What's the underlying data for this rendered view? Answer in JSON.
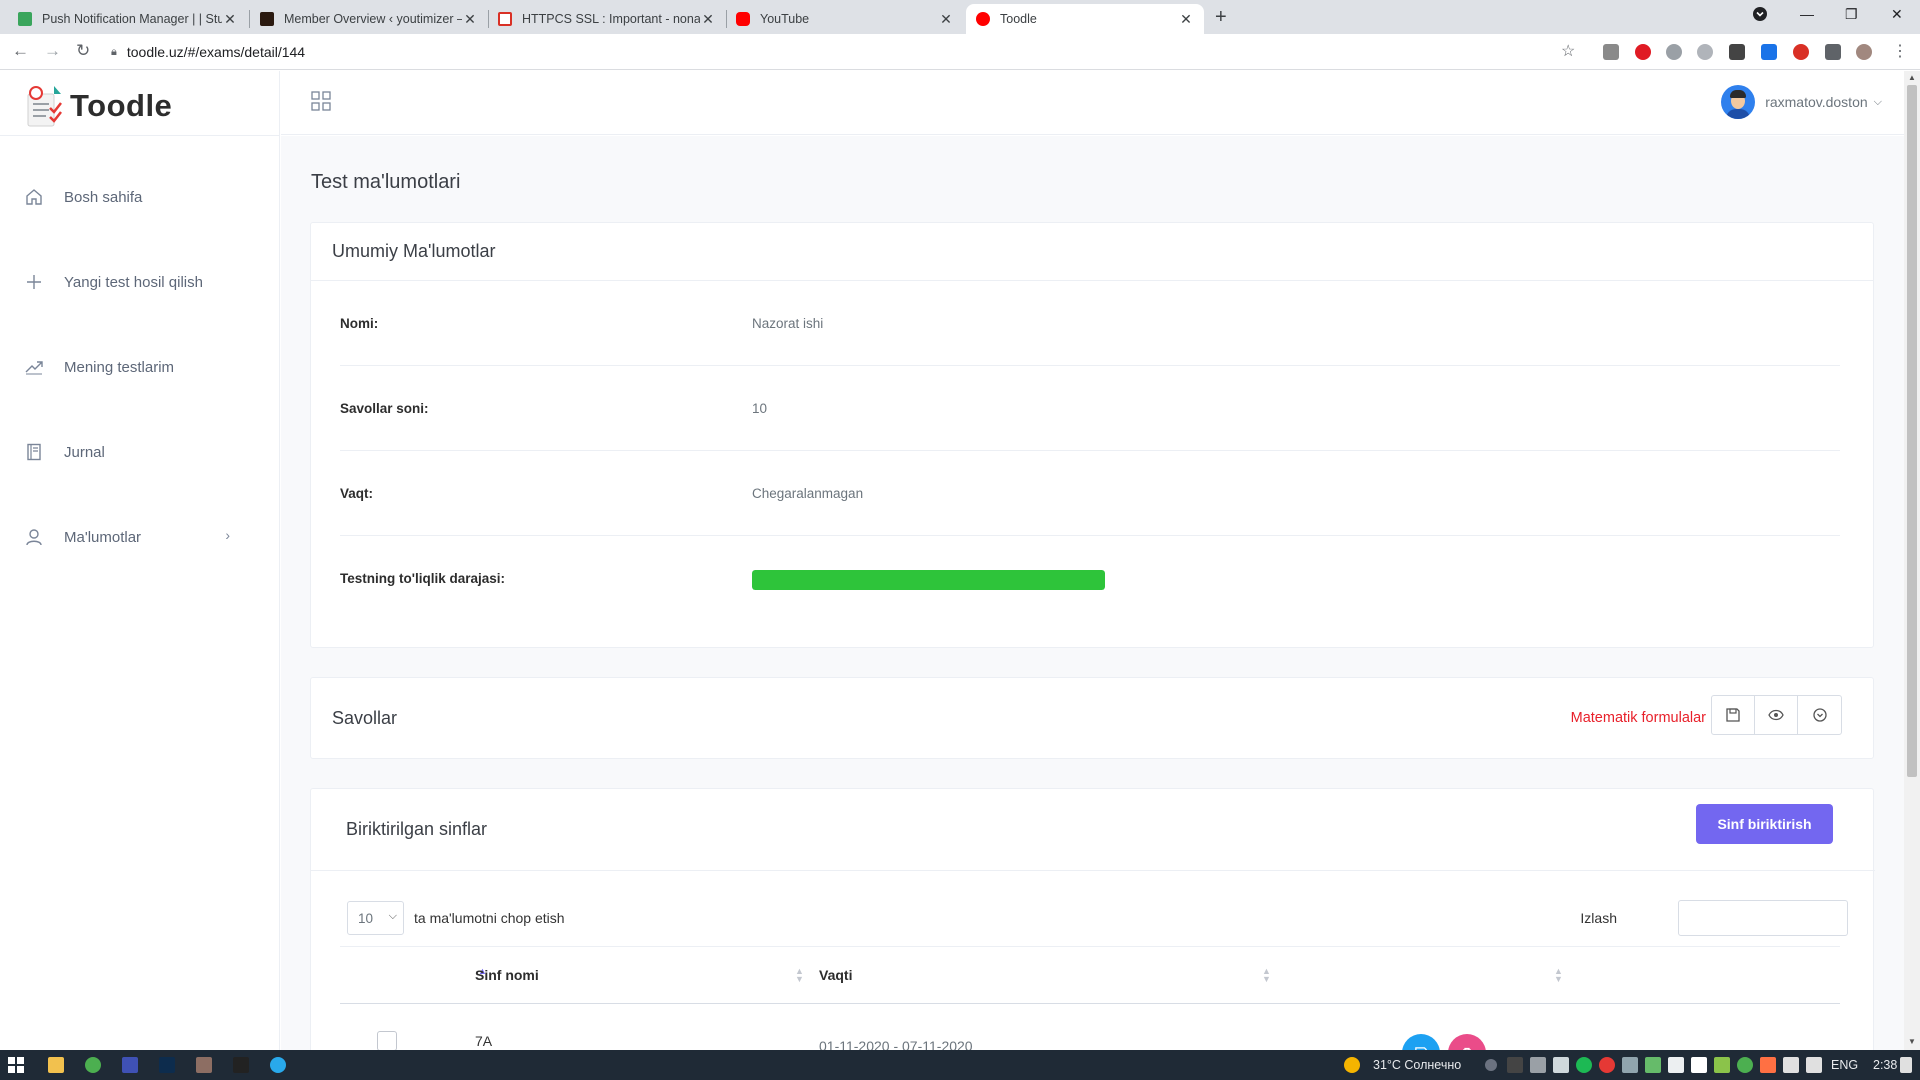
{
  "browser": {
    "tabs": [
      {
        "title": "Push Notification Manager | | Stu",
        "color": "#3aa55c"
      },
      {
        "title": "Member Overview ‹ youtimizer —",
        "color": "#b1350a"
      },
      {
        "title": "HTTPCS SSL : Important - nonam",
        "color": "#d93025"
      },
      {
        "title": "YouTube",
        "color": "#ff0000"
      },
      {
        "title": "Toodle",
        "color": "#ff0000"
      }
    ],
    "url": "toodle.uz/#/exams/detail/144"
  },
  "app": {
    "logo": "Toodle",
    "user": "raxmatov.doston"
  },
  "sidebar": {
    "items": [
      {
        "label": "Bosh sahifa",
        "icon": "home-icon"
      },
      {
        "label": "Yangi test hosil qilish",
        "icon": "plus-icon"
      },
      {
        "label": "Mening testlarim",
        "icon": "trend-icon"
      },
      {
        "label": "Jurnal",
        "icon": "book-icon"
      },
      {
        "label": "Ma'lumotlar",
        "icon": "user-icon"
      }
    ]
  },
  "main": {
    "page_title": "Test ma'lumotlari",
    "general": {
      "title": "Umumiy Ma'lumotlar",
      "rows": [
        {
          "key": "Nomi:",
          "value": "Nazorat ishi"
        },
        {
          "key": "Savollar soni:",
          "value": "10"
        },
        {
          "key": "Vaqt:",
          "value": "Chegaralanmagan"
        },
        {
          "key": "Testning to'liqlik darajasi:",
          "value": ""
        }
      ],
      "completeness": 1.0,
      "progress_color": "#2ec43a"
    },
    "questions": {
      "title": "Savollar",
      "formula_link": "Matematik formulalar"
    },
    "classes": {
      "title": "Biriktirilgan sinflar",
      "assign_button": "Sinf biriktirish",
      "page_length": "10",
      "page_length_label": "ta ma'lumotni chop etish",
      "search_label": "Izlash",
      "columns": [
        "Sinf nomi",
        "Vaqti"
      ],
      "rows": [
        {
          "name": "7A",
          "time": "01-11-2020 - 07-11-2020"
        }
      ]
    }
  },
  "taskbar": {
    "weather": "31°C  Солнечно",
    "lang": "ENG",
    "time": "2:38"
  }
}
